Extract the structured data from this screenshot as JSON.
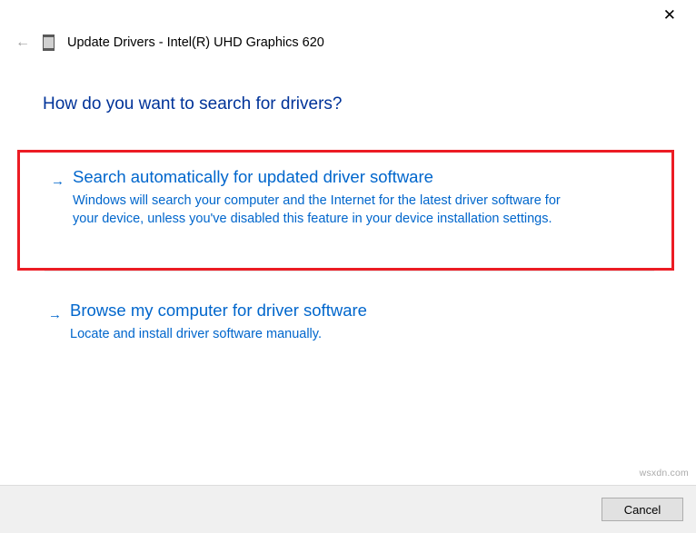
{
  "window": {
    "title": "Update Drivers - Intel(R) UHD Graphics 620"
  },
  "heading": "How do you want to search for drivers?",
  "options": [
    {
      "title": "Search automatically for updated driver software",
      "description": "Windows will search your computer and the Internet for the latest driver software for your device, unless you've disabled this feature in your device installation settings."
    },
    {
      "title": "Browse my computer for driver software",
      "description": "Locate and install driver software manually."
    }
  ],
  "footer": {
    "cancel_label": "Cancel"
  },
  "watermark": "wsxdn.com"
}
